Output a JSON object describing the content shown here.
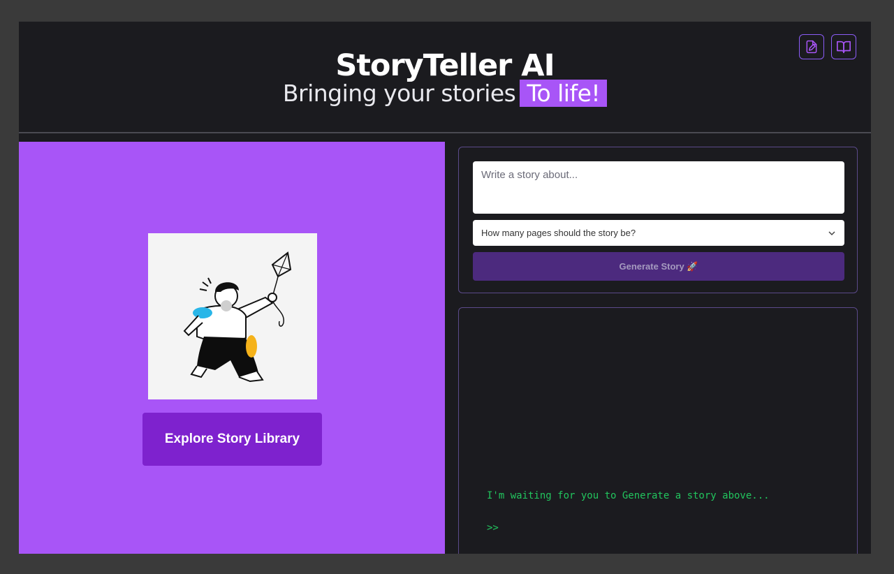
{
  "header": {
    "title": "StoryTeller AI",
    "subtitle_prefix": "Bringing your stories",
    "subtitle_highlight": "To life!",
    "actions": [
      {
        "icon": "file-edit-icon"
      },
      {
        "icon": "book-open-icon"
      }
    ]
  },
  "left": {
    "illustration": "person-flying-kite-illustration",
    "explore_label": "Explore Story Library"
  },
  "form": {
    "story_placeholder": "Write a story about...",
    "pages_placeholder": "How many pages should the story be?",
    "generate_label": "Generate Story 🚀"
  },
  "console": {
    "waiting_text": "I'm waiting for you to Generate a story above...",
    "prompt": ">>"
  },
  "colors": {
    "accent": "#a855f7",
    "button_dark": "#7e22ce",
    "console_text": "#22c55e"
  }
}
